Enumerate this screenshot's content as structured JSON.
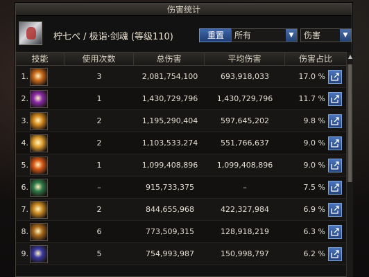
{
  "window": {
    "title": "伤害统计"
  },
  "header": {
    "character": "柠七ぺ / 极诣·剑魂 (等级110)",
    "reset_label": "重置",
    "filter_value": "所有",
    "type_value": "伤害"
  },
  "columns": {
    "skill": "技能",
    "uses": "使用次数",
    "total": "总伤害",
    "avg": "平均伤害",
    "pct": "伤害占比"
  },
  "rows": [
    {
      "idx": "1.",
      "uses": "3",
      "total": "2,081,754,100",
      "avg": "693,918,033",
      "pct": "17.0 %",
      "icon": "blade-slash-icon",
      "color": "#c96a1a"
    },
    {
      "idx": "2.",
      "uses": "1",
      "total": "1,430,729,796",
      "avg": "1,430,729,796",
      "pct": "11.7 %",
      "icon": "purple-burst-icon",
      "color": "#8a2aa8"
    },
    {
      "idx": "3.",
      "uses": "2",
      "total": "1,195,290,404",
      "avg": "597,645,202",
      "pct": "9.8 %",
      "icon": "sword-rain-icon",
      "color": "#d48a1e"
    },
    {
      "idx": "4.",
      "uses": "2",
      "total": "1,103,533,274",
      "avg": "551,766,637",
      "pct": "9.0 %",
      "icon": "spark-explosion-icon",
      "color": "#e0a030"
    },
    {
      "idx": "5.",
      "uses": "1",
      "total": "1,099,408,896",
      "avg": "1,099,408,896",
      "pct": "9.0 %",
      "icon": "flame-wave-icon",
      "color": "#d85a18"
    },
    {
      "idx": "6.",
      "uses": "–",
      "total": "915,733,375",
      "avg": "–",
      "pct": "7.5 %",
      "icon": "green-rune-icon",
      "color": "#2f7a48"
    },
    {
      "idx": "7.",
      "uses": "2",
      "total": "844,655,968",
      "avg": "422,327,984",
      "pct": "6.9 %",
      "icon": "golden-arc-icon",
      "color": "#c98a22"
    },
    {
      "idx": "8.",
      "uses": "6",
      "total": "773,509,315",
      "avg": "128,918,219",
      "pct": "6.3 %",
      "icon": "sword-glyph-icon",
      "color": "#a86a1c"
    },
    {
      "idx": "9.",
      "uses": "5",
      "total": "754,993,987",
      "avg": "150,998,797",
      "pct": "6.2 %",
      "icon": "crescent-slash-icon",
      "color": "#3a3aa0"
    }
  ]
}
